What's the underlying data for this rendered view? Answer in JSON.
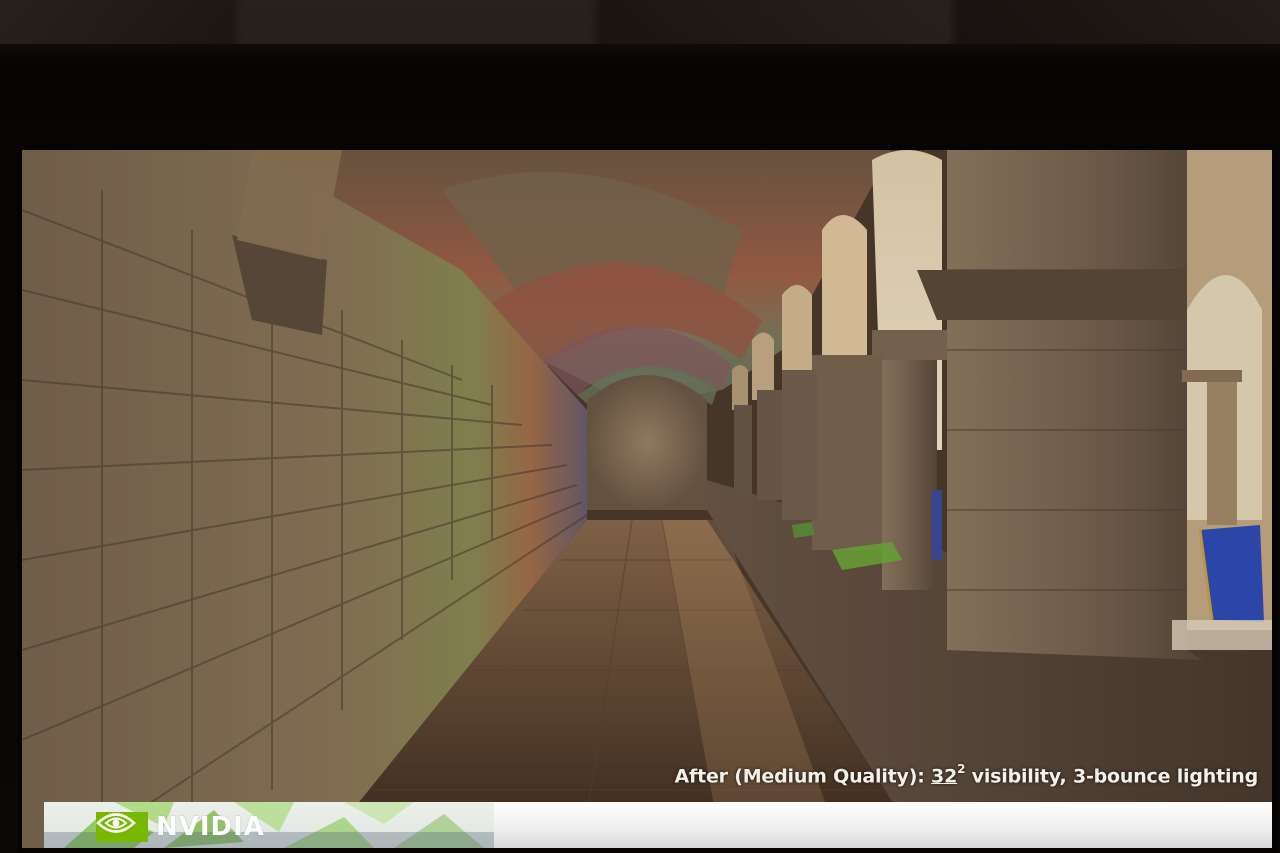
{
  "slide": {
    "caption_prefix": "After (Medium Quality): ",
    "caption_highlight": "32",
    "caption_superscript": "2",
    "caption_suffix": " visibility, 3-bounce lighting",
    "logo_text": "NVIDIA",
    "logo_icon": "nvidia-eye-icon",
    "accent_color": "#76b900"
  }
}
